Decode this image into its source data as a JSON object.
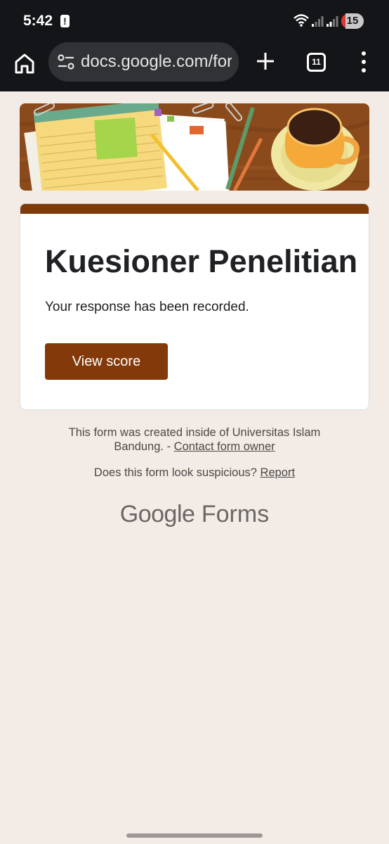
{
  "status_bar": {
    "time": "5:42",
    "battery": "15",
    "icons": [
      "alert-icon",
      "wifi-icon",
      "signal-icon",
      "signal-icon",
      "battery-icon"
    ]
  },
  "browser": {
    "url": "docs.google.com/forms",
    "tab_count": "11",
    "icons": [
      "home-icon",
      "tune-icon",
      "plus-icon",
      "tabs-icon",
      "more-vert-icon"
    ]
  },
  "form": {
    "title": "Kuesioner Penelitian",
    "message": "Your response has been recorded.",
    "view_score_label": "View score",
    "accent_color": "#83390a"
  },
  "footer": {
    "created_text": "This form was created inside of Universitas Islam",
    "org_text": "Bandung. -",
    "contact_link": "Contact form owner",
    "suspicious_text": "Does this form look suspicious?",
    "report_link": "Report",
    "brand_google": "Google",
    "brand_forms": "Forms"
  }
}
